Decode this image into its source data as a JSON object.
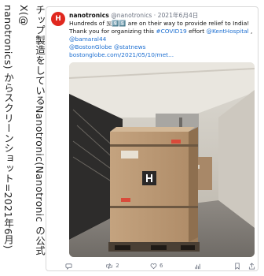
{
  "caption": {
    "lines": [
      "チップ製造をしているNanotronic(Nanotronic の公式X(@",
      "nanotronics) からスクリーンショット=2021年6月)"
    ]
  },
  "tweet": {
    "author_name": "nanotronics",
    "handle": "@nanotronics",
    "separator": " · ",
    "date": "2021年6月4日",
    "text_1": "Hundreds of ",
    "text_2": " are on their way to provide relief to India! Thank you for organizing this ",
    "hashtag": "#COVID19",
    "text_3": " effort ",
    "mention_1": "@KentHospital",
    "text_4": " , ",
    "mention_2": "@bamaral44",
    "mention_3": "@BostonGlobe",
    "mention_4": "@statnews",
    "url": "bostonglobe.com/2021/05/10/met...",
    "counts": {
      "replies": "",
      "retweets": "2",
      "likes": "6",
      "views": ""
    }
  },
  "colors": {
    "brand": "#e0281f",
    "link": "#1d6fd1",
    "muted": "#6b7280"
  },
  "icons": [
    "nanotronics-logo-icon",
    "reply-icon",
    "retweet-icon",
    "like-icon",
    "views-icon",
    "bookmark-icon",
    "share-icon",
    "nanotronics-h-icon"
  ]
}
